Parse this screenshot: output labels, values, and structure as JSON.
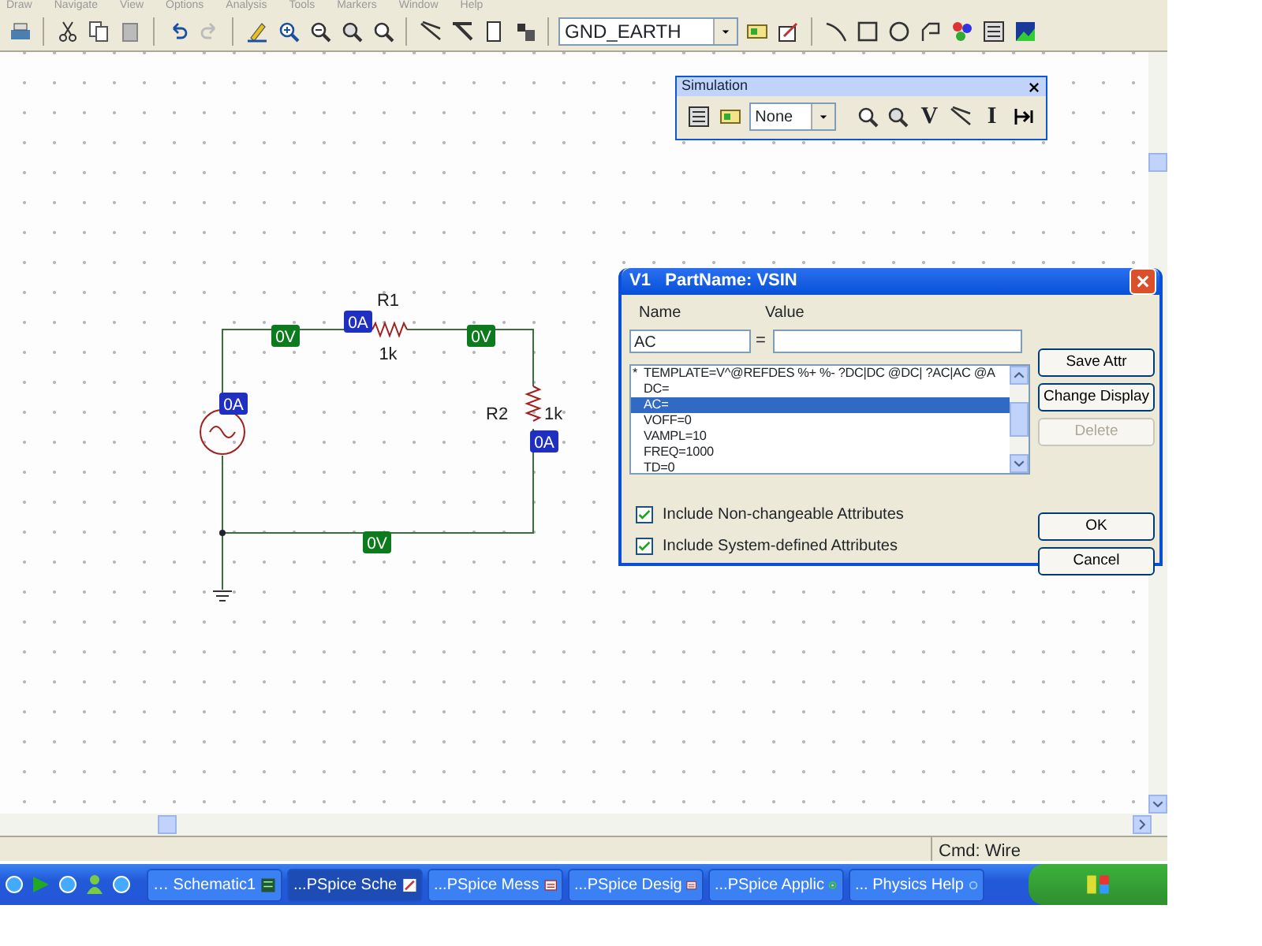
{
  "menu": [
    "Draw",
    "Navigate",
    "View",
    "Options",
    "Analysis",
    "Tools",
    "Markers",
    "Window",
    "Help"
  ],
  "toolbar": {
    "part_combo": "GND_EARTH"
  },
  "simulation_toolbar": {
    "title": "Simulation",
    "combo": "None",
    "letter_buttons": [
      "V",
      "I"
    ]
  },
  "schematic": {
    "parts": [
      {
        "ref": "R1",
        "value": "1k"
      },
      {
        "ref": "R2",
        "value": "1k"
      }
    ],
    "markers": [
      {
        "kind": "voltage",
        "text": "0V"
      },
      {
        "kind": "current",
        "text": "0A"
      },
      {
        "kind": "voltage",
        "text": "0V"
      },
      {
        "kind": "current",
        "text": "0A"
      },
      {
        "kind": "current",
        "text": "0A"
      },
      {
        "kind": "voltage",
        "text": "0V"
      }
    ]
  },
  "dialog": {
    "title": "V1   PartName: VSIN",
    "name_label": "Name",
    "value_label": "Value",
    "name_field": "AC",
    "equals": "=",
    "attributes": [
      {
        "flag": "*",
        "text": "TEMPLATE=V^@REFDES %+ %- ?DC|DC @DC| ?AC|AC @A",
        "selected": false
      },
      {
        "text": "DC=",
        "selected": false
      },
      {
        "text": "AC=",
        "selected": true
      },
      {
        "text": "VOFF=0",
        "selected": false
      },
      {
        "text": "VAMPL=10",
        "selected": false
      },
      {
        "text": "FREQ=1000",
        "selected": false
      },
      {
        "text": "TD=0",
        "selected": false
      }
    ],
    "side_buttons": [
      {
        "label": "Save Attr",
        "disabled": false
      },
      {
        "label": "Change Display",
        "disabled": false
      },
      {
        "label": "Delete",
        "disabled": true
      }
    ],
    "checkboxes": [
      {
        "label": "Include Non-changeable Attributes",
        "checked": true
      },
      {
        "label": "Include System-defined Attributes",
        "checked": true
      }
    ],
    "buttons": [
      "OK",
      "Cancel"
    ]
  },
  "status_bar": {
    "command": "Cmd: Wire"
  },
  "taskbar": [
    {
      "label": "… Schematic1",
      "selected": false
    },
    {
      "label": "...PSpice Sche",
      "selected": true
    },
    {
      "label": "...PSpice Mess",
      "selected": false
    },
    {
      "label": "...PSpice Desig",
      "selected": false
    },
    {
      "label": "...PSpice Applic",
      "selected": false
    },
    {
      "label": "... Physics Help",
      "selected": false
    }
  ]
}
